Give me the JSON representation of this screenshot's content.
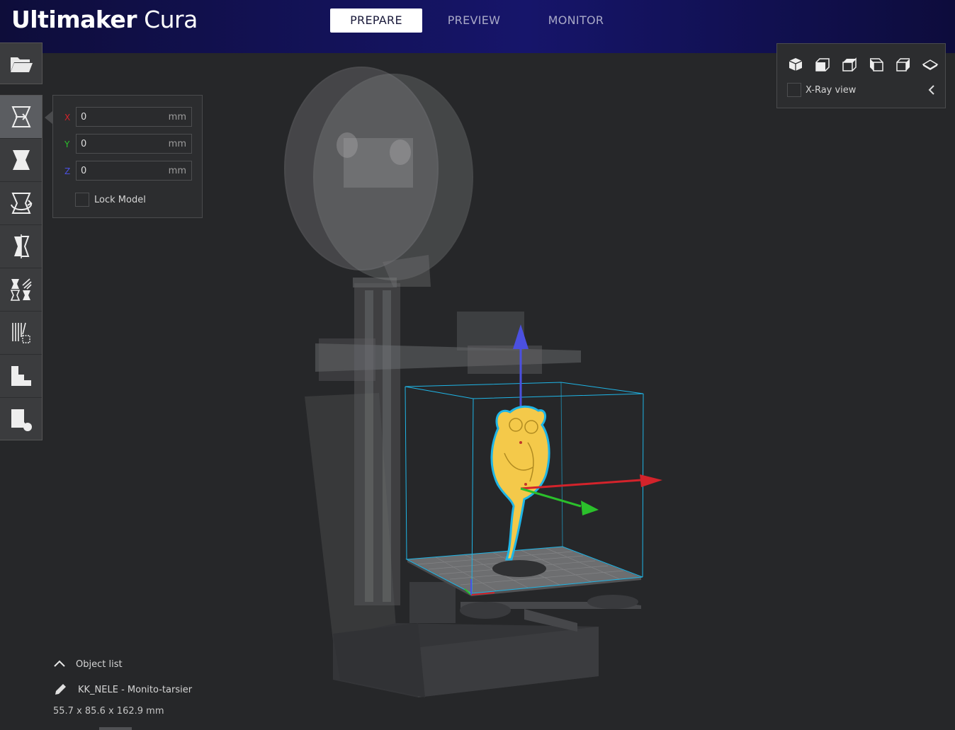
{
  "app": {
    "title_bold": "Ultimaker",
    "title_light": " Cura"
  },
  "stages": [
    {
      "label": "PREPARE",
      "active": true
    },
    {
      "label": "PREVIEW",
      "active": false
    },
    {
      "label": "MONITOR",
      "active": false
    }
  ],
  "toolbar": {
    "open_icon": "folder-open-icon",
    "tools": [
      {
        "name": "move-tool",
        "icon": "move-icon",
        "active": true
      },
      {
        "name": "scale-tool",
        "icon": "scale-icon",
        "active": false
      },
      {
        "name": "rotate-tool",
        "icon": "rotate-icon",
        "active": false
      },
      {
        "name": "mirror-tool",
        "icon": "mirror-icon",
        "active": false
      },
      {
        "name": "per-model-settings-tool",
        "icon": "per-model-settings-icon",
        "active": false
      },
      {
        "name": "support-blocker-tool",
        "icon": "support-blocker-icon",
        "active": false
      },
      {
        "name": "lay-flat-tool",
        "icon": "lay-flat-icon",
        "active": false
      },
      {
        "name": "select-face-tool",
        "icon": "select-face-icon",
        "active": false
      }
    ]
  },
  "move_panel": {
    "x": {
      "label": "X",
      "value": "0",
      "unit": "mm",
      "color": "#d3232b"
    },
    "y": {
      "label": "Y",
      "value": "0",
      "unit": "mm",
      "color": "#2bc02b"
    },
    "z": {
      "label": "Z",
      "value": "0",
      "unit": "mm",
      "color": "#4b50e0"
    },
    "lock_label": "Lock Model",
    "lock_checked": false
  },
  "view_panel": {
    "views": [
      "3d-view-icon",
      "front-view-icon",
      "top-view-icon",
      "left-view-icon",
      "right-view-icon",
      "layer-view-icon"
    ],
    "xray_label": "X-Ray view",
    "xray_checked": false
  },
  "object_list": {
    "header": "Object list",
    "object_name": "KK_NELE - Monito-tarsier",
    "dimensions": "55.7 x 85.6 x 162.9 mm"
  },
  "colors": {
    "header_bg": "#16156a",
    "model": "#f4c94a",
    "selection": "#1fb5e6",
    "axis_x": "#d3232b",
    "axis_y": "#2bc02b",
    "axis_z": "#4b50e0"
  }
}
